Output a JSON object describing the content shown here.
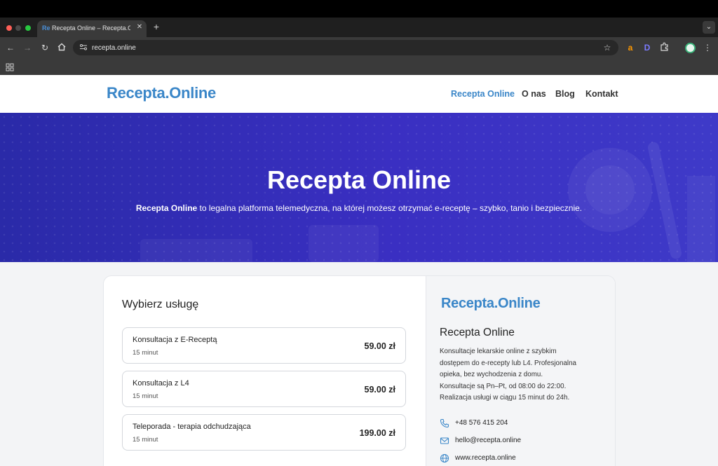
{
  "browser": {
    "tab": {
      "favicon": "Re",
      "title": "Recepta Online – Recepta.Online"
    },
    "url": "recepta.online",
    "icons": [
      "back-icon",
      "forward-icon",
      "reload-icon",
      "home-icon",
      "site-info-icon",
      "bookmark-star-icon",
      "amazon-extension-icon",
      "d-extension-icon",
      "extensions-puzzle-icon",
      "profile-avatar",
      "menu-kebab-icon",
      "apps-grid-icon"
    ],
    "ext_a": "a",
    "ext_d": "D"
  },
  "site": {
    "logo": "Recepta.Online",
    "nav": [
      {
        "label": "Recepta Online",
        "active": true
      },
      {
        "label": "O nas",
        "active": false
      },
      {
        "label": "Blog",
        "active": false
      },
      {
        "label": "Kontakt",
        "active": false
      }
    ],
    "colors": {
      "brand": "#3a86c8",
      "hero": "#3a2fc2",
      "nav_active": "#3a86c8"
    }
  },
  "hero": {
    "title": "Recepta Online",
    "subtitle_bold": "Recepta Online",
    "subtitle_rest": " to legalna platforma telemedyczna, na której możesz otrzymać e-receptę – szybko, tanio i bezpiecznie."
  },
  "services": {
    "title": "Wybierz usługę",
    "items": [
      {
        "name": "Konsultacja z E-Receptą",
        "duration": "15 minut",
        "price": "59.00 zł"
      },
      {
        "name": "Konsultacja z L4",
        "duration": "15 minut",
        "price": "59.00 zł"
      },
      {
        "name": "Teleporada - terapia odchudzająca",
        "duration": "15 minut",
        "price": "199.00 zł"
      }
    ]
  },
  "sidebar": {
    "logo": "Recepta.Online",
    "name": "Recepta Online",
    "description_lines": [
      "Konsultacje lekarskie online z szybkim",
      "dostępem do e-recepty lub L4. Profesjonalna",
      "opieka, bez wychodzenia z domu.",
      "Konsultacje są Pn–Pt, od 08:00 do 22:00.",
      "Realizacja usługi w ciągu 15 minut do 24h."
    ],
    "contacts": [
      {
        "icon": "phone-icon",
        "text": "+48 576 415 204"
      },
      {
        "icon": "mail-icon",
        "text": "hello@recepta.online"
      },
      {
        "icon": "globe-icon",
        "text": "www.recepta.online"
      }
    ]
  }
}
